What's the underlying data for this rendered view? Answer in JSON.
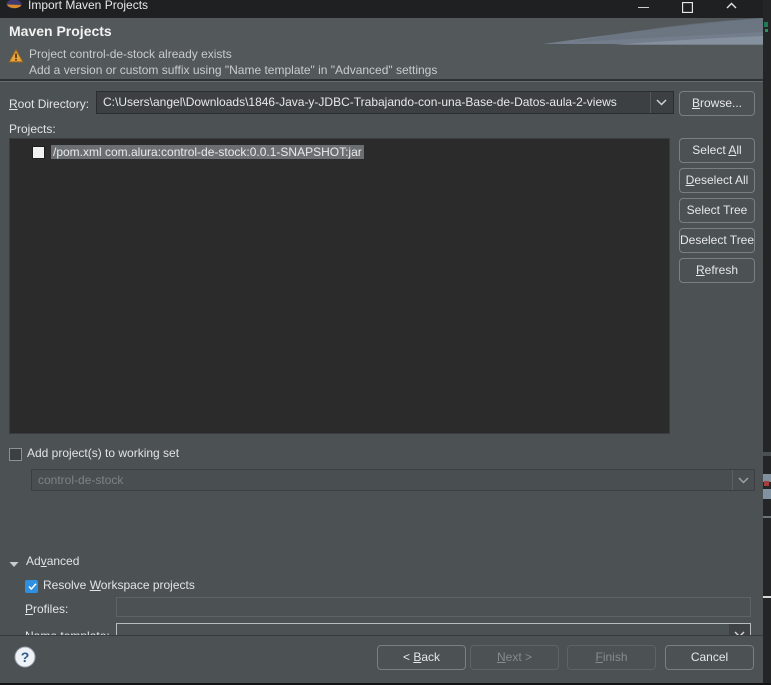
{
  "window": {
    "title": "Import Maven Projects",
    "icon": "eclipse-icon",
    "controls": {
      "minimize": "minimize-icon",
      "maximize": "maximize-icon",
      "close": "close-icon"
    }
  },
  "header": {
    "title": "Maven Projects",
    "warning_icon": "warning-icon",
    "message_line1": "Project control-de-stock already exists",
    "message_line2": "Add a version or custom suffix using \"Name template\" in \"Advanced\" settings"
  },
  "form": {
    "root_directory": {
      "label": "Root Directory:",
      "mnemonic": "R",
      "value": "C:\\Users\\angel\\Downloads\\1846-Java-y-JDBC-Trabajando-con-una-Base-de-Datos-aula-2-views",
      "dropdown_icon": "chevron-down-icon"
    },
    "browse_button": {
      "label": "Browse...",
      "mnemonic": "B"
    },
    "projects": {
      "label": "Projects:",
      "items": [
        {
          "checked": false,
          "text": "/pom.xml  com.alura:control-de-stock:0.0.1-SNAPSHOT:jar",
          "selected": true
        }
      ]
    },
    "side_buttons": [
      {
        "label": "Select All",
        "mnemonic": "A"
      },
      {
        "label": "Deselect All",
        "mnemonic": "D"
      },
      {
        "label": "Select Tree",
        "mnemonic": ""
      },
      {
        "label": "Deselect Tree",
        "mnemonic": ""
      },
      {
        "label": "Refresh",
        "mnemonic": "R"
      }
    ],
    "working_set": {
      "checkbox_label": "Add project(s) to working set",
      "checked": false,
      "combo_value": "control-de-stock",
      "combo_enabled": false,
      "dropdown_icon": "chevron-down-icon"
    },
    "advanced": {
      "label": "Advanced",
      "mnemonic": "v",
      "expanded": true,
      "twisty_icon": "triangle-down-icon",
      "resolve_workspace": {
        "label": "Resolve Workspace projects",
        "mnemonic": "W",
        "checked": true
      },
      "profiles": {
        "label": "Profiles:",
        "mnemonic": "P",
        "value": ""
      },
      "name_template": {
        "label": "Name template:",
        "mnemonic": "t",
        "value": "",
        "dropdown_icon": "chevron-down-icon"
      }
    }
  },
  "footer": {
    "help_icon": "help-icon",
    "buttons": [
      {
        "label": "< Back",
        "mnemonic": "B",
        "enabled": true
      },
      {
        "label": "Next >",
        "mnemonic": "N",
        "enabled": false
      },
      {
        "label": "Finish",
        "mnemonic": "F",
        "enabled": false
      },
      {
        "label": "Cancel",
        "mnemonic": "",
        "enabled": true
      }
    ]
  },
  "colors": {
    "dialog_bg": "#4c5154",
    "header_bg": "#53585b",
    "titlebar_bg": "#1f2022",
    "list_bg": "#2b2b2b",
    "accent_checked": "#2f8fe0",
    "warning": "#e8a33d",
    "text": "#e2e4e5",
    "text_disabled": "#868b8e"
  }
}
